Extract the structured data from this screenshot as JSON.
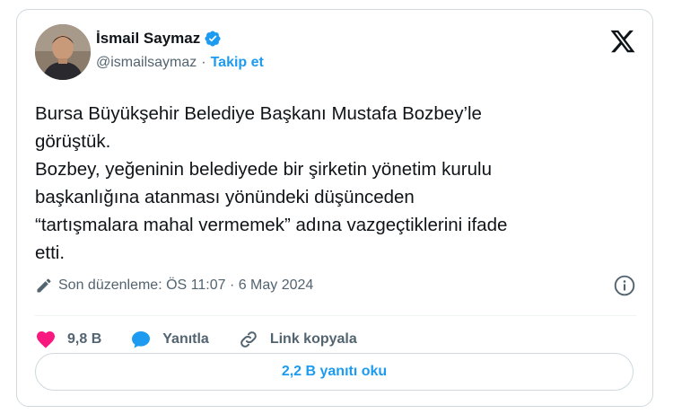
{
  "author": {
    "display_name": "İsmail Saymaz",
    "handle": "@ismailsaymaz",
    "separator": "·",
    "follow_label": "Takip et",
    "verified_color": "#1d9bf0"
  },
  "tweet": {
    "text": "Bursa Büyükşehir Belediye Başkanı Mustafa Bozbey’le\ngörüştük.\nBozbey, yeğeninin belediyede bir şirketin yönetim kurulu\nbaşkanlığına atanması yönündeki düşünceden\n“tartışmalara mahal vermemek” adına vazgeçtiklerini ifade\netti.",
    "edited_label": "Son düzenleme: ÖS 11:07 · 6 May 2024"
  },
  "actions": {
    "like_count": "9,8 B",
    "reply_label": "Yanıtla",
    "copy_link_label": "Link kopyala",
    "like_color": "#f91880",
    "reply_color": "#1d9bf0"
  },
  "read_replies_label": "2,2 B yanıtı oku",
  "icons": [
    "x-logo-icon",
    "verified-icon",
    "pencil-icon",
    "info-icon",
    "heart-icon",
    "reply-icon",
    "link-icon"
  ]
}
